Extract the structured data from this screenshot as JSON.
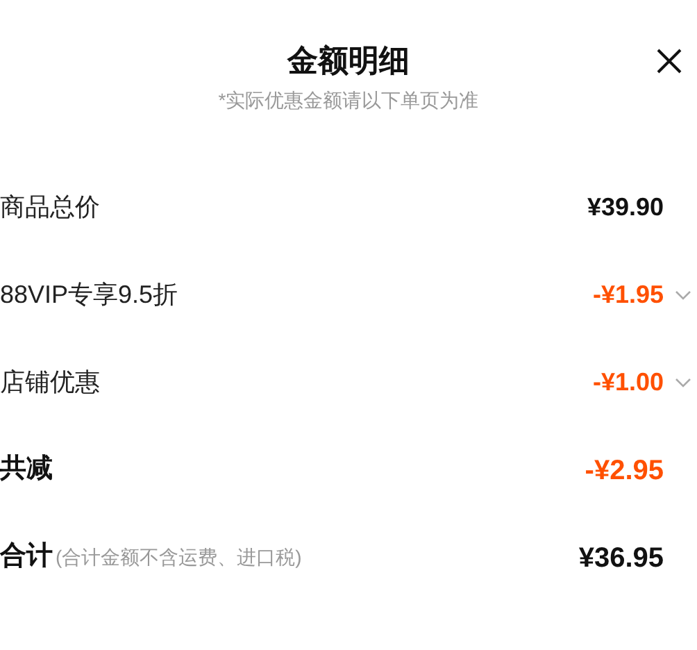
{
  "header": {
    "title": "金额明细",
    "subtitle": "*实际优惠金额请以下单页为准"
  },
  "rows": [
    {
      "kind": "price",
      "label": "商品总价",
      "value": "¥39.90"
    },
    {
      "kind": "discount",
      "label": "88VIP专享9.5折",
      "value": "-¥1.95"
    },
    {
      "kind": "discount",
      "label": "店铺优惠",
      "value": "-¥1.00"
    },
    {
      "kind": "sum",
      "label": "共减",
      "value": "-¥2.95"
    },
    {
      "kind": "total",
      "label": "合计",
      "note": "(合计金额不含运费、进口税)",
      "value": "¥36.95"
    }
  ]
}
